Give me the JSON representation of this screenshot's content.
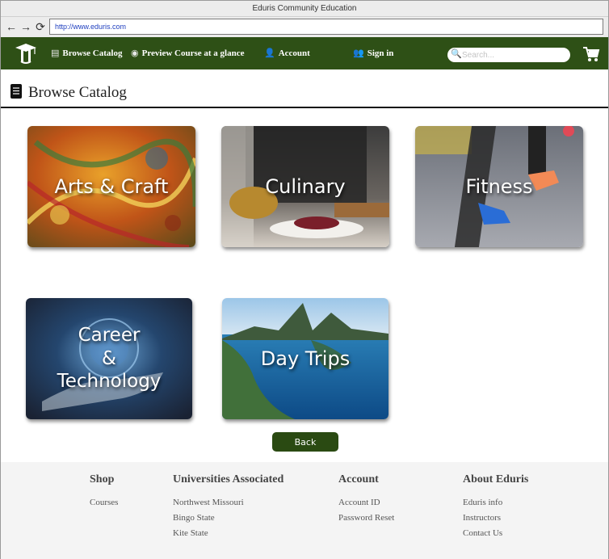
{
  "window": {
    "title": "Eduris Community Education"
  },
  "browser": {
    "back_glyph": "←",
    "forward_glyph": "→",
    "reload_glyph": "⟳",
    "url": "http://www.eduris.com"
  },
  "nav": {
    "browse_catalog": "Browse Catalog",
    "preview_course": "Preview Course at a glance",
    "account": "Account",
    "sign_in": "Sign in",
    "search_placeholder": "Search...",
    "colors": {
      "bar": "#2e5016",
      "button": "#2a4a12"
    }
  },
  "page": {
    "title": "Browse Catalog"
  },
  "categories": [
    {
      "label": "Arts & Craft"
    },
    {
      "label": "Culinary"
    },
    {
      "label": "Fitness"
    },
    {
      "label_lines": [
        "Career",
        "&",
        "Technology"
      ]
    },
    {
      "label": "Day Trips"
    }
  ],
  "back_button": "Back",
  "footer": {
    "shop": {
      "title": "Shop",
      "links": [
        "Courses"
      ]
    },
    "universities": {
      "title": "Universities Associated",
      "links": [
        "Northwest Missouri",
        "Bingo State",
        "Kite State"
      ]
    },
    "account": {
      "title": "Account",
      "links": [
        "Account ID",
        "Password Reset"
      ]
    },
    "about": {
      "title": "About Eduris",
      "links": [
        "Eduris info",
        "Instructors",
        "Contact Us"
      ]
    }
  }
}
